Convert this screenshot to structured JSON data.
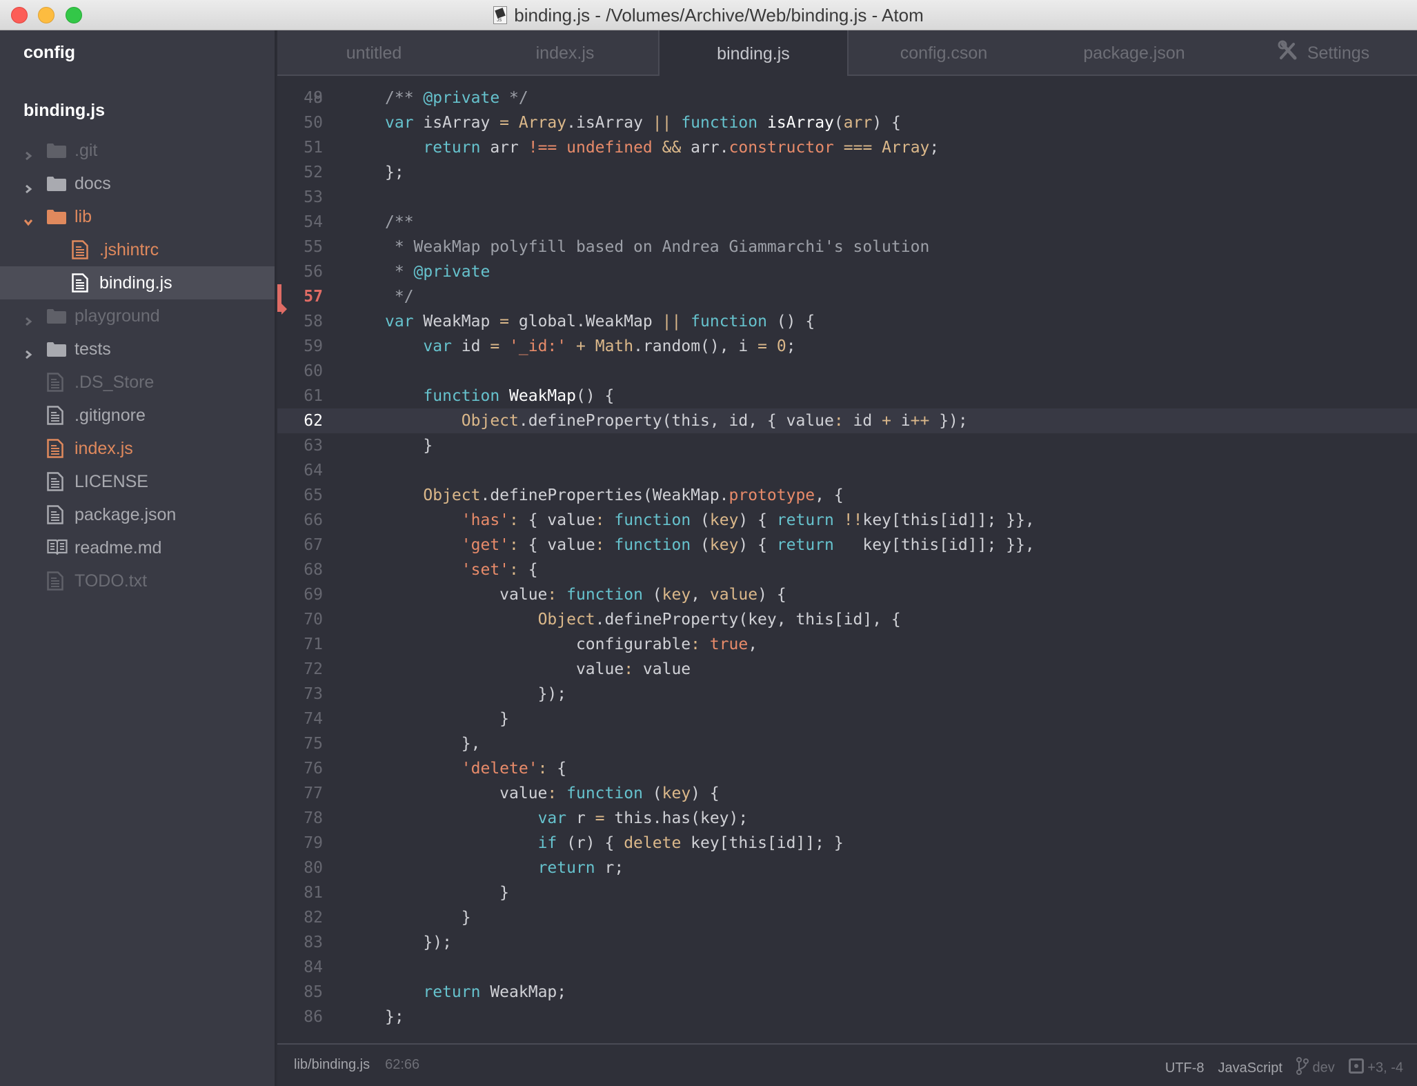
{
  "window": {
    "title": "binding.js - /Volumes/Archive/Web/binding.js - Atom",
    "file_icon": "js-document-icon"
  },
  "sidebar": {
    "config_label": "config",
    "project_label": "binding.js",
    "items": [
      {
        "label": ".git",
        "type": "folder",
        "expanded": false,
        "state": "ignored"
      },
      {
        "label": "docs",
        "type": "folder",
        "expanded": false,
        "state": "normal"
      },
      {
        "label": "lib",
        "type": "folder",
        "expanded": true,
        "state": "modified"
      },
      {
        "label": ".jshintrc",
        "type": "file",
        "state": "modified",
        "depth": 1
      },
      {
        "label": "binding.js",
        "type": "file",
        "state": "selected",
        "depth": 1
      },
      {
        "label": "playground",
        "type": "folder",
        "expanded": false,
        "state": "ignored"
      },
      {
        "label": "tests",
        "type": "folder",
        "expanded": false,
        "state": "normal"
      },
      {
        "label": ".DS_Store",
        "type": "file",
        "state": "ignored"
      },
      {
        "label": ".gitignore",
        "type": "file",
        "state": "normal"
      },
      {
        "label": "index.js",
        "type": "file",
        "state": "modified"
      },
      {
        "label": "LICENSE",
        "type": "file",
        "state": "normal"
      },
      {
        "label": "package.json",
        "type": "file",
        "state": "normal"
      },
      {
        "label": "readme.md",
        "type": "book",
        "state": "normal"
      },
      {
        "label": "TODO.txt",
        "type": "file",
        "state": "ignored"
      }
    ]
  },
  "tabs": [
    {
      "label": "untitled",
      "active": false
    },
    {
      "label": "index.js",
      "active": false
    },
    {
      "label": "binding.js",
      "active": true
    },
    {
      "label": "config.cson",
      "active": false
    },
    {
      "label": "package.json",
      "active": false
    },
    {
      "label": "Settings",
      "active": false,
      "icon": "tools-icon"
    }
  ],
  "editor": {
    "first_partial_line": "48",
    "last_partial_line": "87",
    "cursor_line": 62,
    "modified_line": 57,
    "lines": [
      {
        "n": 49,
        "tokens": [
          [
            "cm",
            "/** "
          ],
          [
            "tag",
            "@private"
          ],
          [
            "cm",
            " */"
          ]
        ],
        "indent": 0
      },
      {
        "n": 50,
        "tokens": [
          [
            "kw",
            "var"
          ],
          [
            "plain",
            " isArray "
          ],
          [
            "op",
            "="
          ],
          [
            "plain",
            " "
          ],
          [
            "cls",
            "Array"
          ],
          [
            "plain",
            ".isArray "
          ],
          [
            "op",
            "||"
          ],
          [
            "plain",
            " "
          ],
          [
            "kw",
            "function"
          ],
          [
            "plain",
            " "
          ],
          [
            "fnname",
            "isArray"
          ],
          [
            "plain",
            "("
          ],
          [
            "prm",
            "arr"
          ],
          [
            "plain",
            ") {"
          ]
        ],
        "indent": 0
      },
      {
        "n": 51,
        "tokens": [
          [
            "kw",
            "return"
          ],
          [
            "plain",
            " arr "
          ],
          [
            "str",
            "!=="
          ],
          [
            "plain",
            " "
          ],
          [
            "str",
            "undefined"
          ],
          [
            "plain",
            " "
          ],
          [
            "op",
            "&&"
          ],
          [
            "plain",
            " arr."
          ],
          [
            "prop",
            "constructor"
          ],
          [
            "plain",
            " "
          ],
          [
            "op",
            "==="
          ],
          [
            "plain",
            " "
          ],
          [
            "cls",
            "Array"
          ],
          [
            "plain",
            ";"
          ]
        ],
        "indent": 1
      },
      {
        "n": 52,
        "tokens": [
          [
            "plain",
            "};"
          ]
        ],
        "indent": 0
      },
      {
        "n": 53,
        "tokens": [],
        "indent": 0
      },
      {
        "n": 54,
        "tokens": [
          [
            "cm",
            "/**"
          ]
        ],
        "indent": 0
      },
      {
        "n": 55,
        "tokens": [
          [
            "cm",
            " * WeakMap polyfill based on Andrea Giammarchi's solution"
          ]
        ],
        "indent": 0
      },
      {
        "n": 56,
        "tokens": [
          [
            "cm",
            " * "
          ],
          [
            "tag",
            "@private"
          ]
        ],
        "indent": 0
      },
      {
        "n": 57,
        "tokens": [
          [
            "cm",
            " */"
          ]
        ],
        "indent": 0
      },
      {
        "n": 58,
        "tokens": [
          [
            "kw",
            "var"
          ],
          [
            "plain",
            " WeakMap "
          ],
          [
            "op",
            "="
          ],
          [
            "plain",
            " global.WeakMap "
          ],
          [
            "op",
            "||"
          ],
          [
            "plain",
            " "
          ],
          [
            "kw",
            "function"
          ],
          [
            "plain",
            " () {"
          ]
        ],
        "indent": 0
      },
      {
        "n": 59,
        "tokens": [
          [
            "kw",
            "var"
          ],
          [
            "plain",
            " id "
          ],
          [
            "op",
            "="
          ],
          [
            "plain",
            " "
          ],
          [
            "str",
            "'_id:'"
          ],
          [
            "plain",
            " "
          ],
          [
            "op",
            "+"
          ],
          [
            "plain",
            " "
          ],
          [
            "cls",
            "Math"
          ],
          [
            "plain",
            ".random(), i "
          ],
          [
            "op",
            "="
          ],
          [
            "plain",
            " "
          ],
          [
            "num",
            "0"
          ],
          [
            "plain",
            ";"
          ]
        ],
        "indent": 1
      },
      {
        "n": 60,
        "tokens": [],
        "indent": 0
      },
      {
        "n": 61,
        "tokens": [
          [
            "kw",
            "function"
          ],
          [
            "plain",
            " "
          ],
          [
            "fnname",
            "WeakMap"
          ],
          [
            "plain",
            "() {"
          ]
        ],
        "indent": 1
      },
      {
        "n": 62,
        "tokens": [
          [
            "cls",
            "Object"
          ],
          [
            "plain",
            ".defineProperty(this, id, { value"
          ],
          [
            "op",
            ":"
          ],
          [
            "plain",
            " id "
          ],
          [
            "op",
            "+"
          ],
          [
            "plain",
            " i"
          ],
          [
            "op",
            "++"
          ],
          [
            "plain",
            " });"
          ]
        ],
        "indent": 2
      },
      {
        "n": 63,
        "tokens": [
          [
            "plain",
            "}"
          ]
        ],
        "indent": 1
      },
      {
        "n": 64,
        "tokens": [],
        "indent": 0
      },
      {
        "n": 65,
        "tokens": [
          [
            "cls",
            "Object"
          ],
          [
            "plain",
            ".defineProperties(WeakMap."
          ],
          [
            "prop",
            "prototype"
          ],
          [
            "plain",
            ", {"
          ]
        ],
        "indent": 1
      },
      {
        "n": 66,
        "tokens": [
          [
            "str",
            "'has'"
          ],
          [
            "op",
            ":"
          ],
          [
            "plain",
            " { value"
          ],
          [
            "op",
            ":"
          ],
          [
            "plain",
            " "
          ],
          [
            "kw",
            "function"
          ],
          [
            "plain",
            " ("
          ],
          [
            "prm",
            "key"
          ],
          [
            "plain",
            ") { "
          ],
          [
            "kw",
            "return"
          ],
          [
            "plain",
            " "
          ],
          [
            "op",
            "!!"
          ],
          [
            "plain",
            "key[this[id]]; }},"
          ]
        ],
        "indent": 2
      },
      {
        "n": 67,
        "tokens": [
          [
            "str",
            "'get'"
          ],
          [
            "op",
            ":"
          ],
          [
            "plain",
            " { value"
          ],
          [
            "op",
            ":"
          ],
          [
            "plain",
            " "
          ],
          [
            "kw",
            "function"
          ],
          [
            "plain",
            " ("
          ],
          [
            "prm",
            "key"
          ],
          [
            "plain",
            ") { "
          ],
          [
            "kw",
            "return"
          ],
          [
            "plain",
            "   key[this[id]]; }},"
          ]
        ],
        "indent": 2
      },
      {
        "n": 68,
        "tokens": [
          [
            "str",
            "'set'"
          ],
          [
            "op",
            ":"
          ],
          [
            "plain",
            " {"
          ]
        ],
        "indent": 2
      },
      {
        "n": 69,
        "tokens": [
          [
            "plain",
            "value"
          ],
          [
            "op",
            ":"
          ],
          [
            "plain",
            " "
          ],
          [
            "kw",
            "function"
          ],
          [
            "plain",
            " ("
          ],
          [
            "prm",
            "key"
          ],
          [
            "plain",
            ", "
          ],
          [
            "prm",
            "value"
          ],
          [
            "plain",
            ") {"
          ]
        ],
        "indent": 3
      },
      {
        "n": 70,
        "tokens": [
          [
            "cls",
            "Object"
          ],
          [
            "plain",
            ".defineProperty(key, this[id], {"
          ]
        ],
        "indent": 4
      },
      {
        "n": 71,
        "tokens": [
          [
            "plain",
            "configurable"
          ],
          [
            "op",
            ":"
          ],
          [
            "plain",
            " "
          ],
          [
            "str",
            "true"
          ],
          [
            "plain",
            ","
          ]
        ],
        "indent": 5
      },
      {
        "n": 72,
        "tokens": [
          [
            "plain",
            "value"
          ],
          [
            "op",
            ":"
          ],
          [
            "plain",
            " value"
          ]
        ],
        "indent": 5
      },
      {
        "n": 73,
        "tokens": [
          [
            "plain",
            "});"
          ]
        ],
        "indent": 4
      },
      {
        "n": 74,
        "tokens": [
          [
            "plain",
            "}"
          ]
        ],
        "indent": 3
      },
      {
        "n": 75,
        "tokens": [
          [
            "plain",
            "},"
          ]
        ],
        "indent": 2
      },
      {
        "n": 76,
        "tokens": [
          [
            "str",
            "'delete'"
          ],
          [
            "op",
            ":"
          ],
          [
            "plain",
            " {"
          ]
        ],
        "indent": 2
      },
      {
        "n": 77,
        "tokens": [
          [
            "plain",
            "value"
          ],
          [
            "op",
            ":"
          ],
          [
            "plain",
            " "
          ],
          [
            "kw",
            "function"
          ],
          [
            "plain",
            " ("
          ],
          [
            "prm",
            "key"
          ],
          [
            "plain",
            ") {"
          ]
        ],
        "indent": 3
      },
      {
        "n": 78,
        "tokens": [
          [
            "kw",
            "var"
          ],
          [
            "plain",
            " r "
          ],
          [
            "op",
            "="
          ],
          [
            "plain",
            " this.has(key);"
          ]
        ],
        "indent": 4
      },
      {
        "n": 79,
        "tokens": [
          [
            "kw",
            "if"
          ],
          [
            "plain",
            " (r) { "
          ],
          [
            "op",
            "delete"
          ],
          [
            "plain",
            " key[this[id]]; }"
          ]
        ],
        "indent": 4
      },
      {
        "n": 80,
        "tokens": [
          [
            "kw",
            "return"
          ],
          [
            "plain",
            " r;"
          ]
        ],
        "indent": 4
      },
      {
        "n": 81,
        "tokens": [
          [
            "plain",
            "}"
          ]
        ],
        "indent": 3
      },
      {
        "n": 82,
        "tokens": [
          [
            "plain",
            "}"
          ]
        ],
        "indent": 2
      },
      {
        "n": 83,
        "tokens": [
          [
            "plain",
            "});"
          ]
        ],
        "indent": 1
      },
      {
        "n": 84,
        "tokens": [],
        "indent": 0
      },
      {
        "n": 85,
        "tokens": [
          [
            "kw",
            "return"
          ],
          [
            "plain",
            " WeakMap;"
          ]
        ],
        "indent": 1
      },
      {
        "n": 86,
        "tokens": [
          [
            "plain",
            "};"
          ]
        ],
        "indent": 0
      }
    ]
  },
  "statusbar": {
    "file_path": "lib/binding.js",
    "cursor_position": "62:66",
    "encoding": "UTF-8",
    "grammar": "JavaScript",
    "branch": "dev",
    "diff_stats": "+3, -4"
  },
  "colors": {
    "accent_modified": "#e0895d",
    "git_marker": "#e06c65",
    "keyword": "#66c2cd",
    "class": "#dbb88a",
    "string": "#e88b6a"
  }
}
